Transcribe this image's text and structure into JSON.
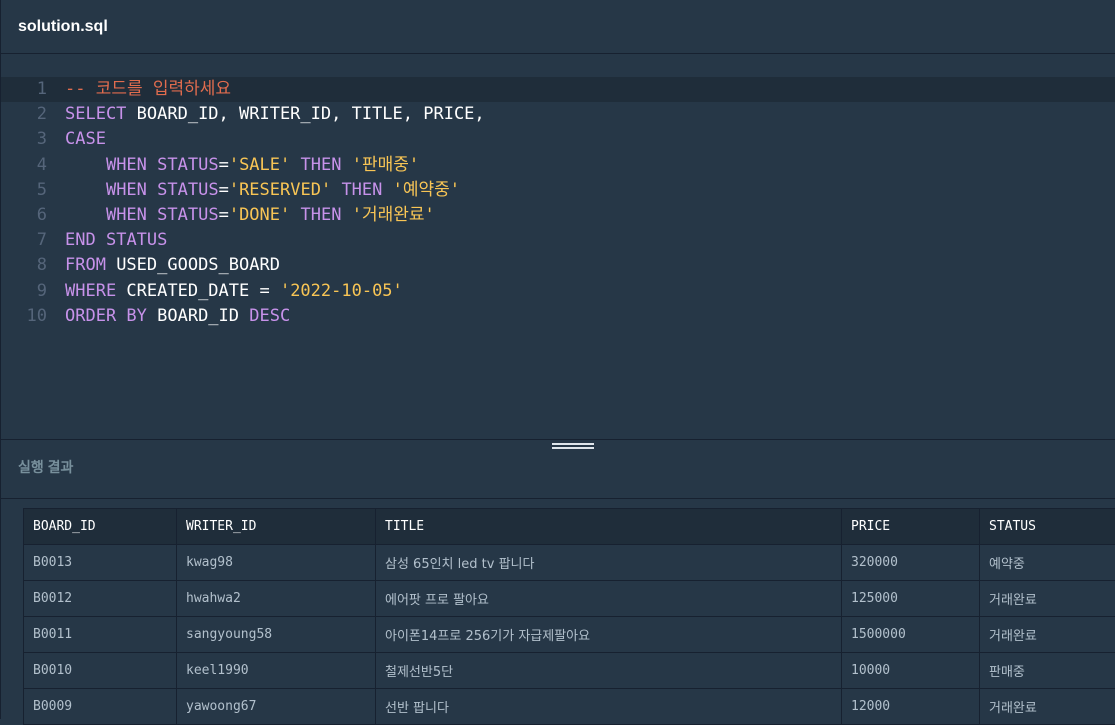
{
  "file_tab": {
    "name": "solution.sql"
  },
  "editor": {
    "active_line": 1,
    "lines": [
      {
        "n": "1",
        "tokens": [
          {
            "t": "cm",
            "v": "-- 코드를 입력하세요"
          }
        ]
      },
      {
        "n": "2",
        "tokens": [
          {
            "t": "kw",
            "v": "SELECT"
          },
          {
            "t": "id",
            "v": " BOARD_ID, WRITER_ID, TITLE, PRICE,"
          }
        ]
      },
      {
        "n": "3",
        "tokens": [
          {
            "t": "kw",
            "v": "CASE"
          }
        ]
      },
      {
        "n": "4",
        "tokens": [
          {
            "t": "id",
            "v": "    "
          },
          {
            "t": "kw",
            "v": "WHEN"
          },
          {
            "t": "id",
            "v": " "
          },
          {
            "t": "kw",
            "v": "STATUS"
          },
          {
            "t": "id",
            "v": "="
          },
          {
            "t": "str",
            "v": "'SALE'"
          },
          {
            "t": "id",
            "v": " "
          },
          {
            "t": "kw",
            "v": "THEN"
          },
          {
            "t": "id",
            "v": " "
          },
          {
            "t": "str",
            "v": "'판매중'"
          }
        ]
      },
      {
        "n": "5",
        "tokens": [
          {
            "t": "id",
            "v": "    "
          },
          {
            "t": "kw",
            "v": "WHEN"
          },
          {
            "t": "id",
            "v": " "
          },
          {
            "t": "kw",
            "v": "STATUS"
          },
          {
            "t": "id",
            "v": "="
          },
          {
            "t": "str",
            "v": "'RESERVED'"
          },
          {
            "t": "id",
            "v": " "
          },
          {
            "t": "kw",
            "v": "THEN"
          },
          {
            "t": "id",
            "v": " "
          },
          {
            "t": "str",
            "v": "'예약중'"
          }
        ]
      },
      {
        "n": "6",
        "tokens": [
          {
            "t": "id",
            "v": "    "
          },
          {
            "t": "kw",
            "v": "WHEN"
          },
          {
            "t": "id",
            "v": " "
          },
          {
            "t": "kw",
            "v": "STATUS"
          },
          {
            "t": "id",
            "v": "="
          },
          {
            "t": "str",
            "v": "'DONE'"
          },
          {
            "t": "id",
            "v": " "
          },
          {
            "t": "kw",
            "v": "THEN"
          },
          {
            "t": "id",
            "v": " "
          },
          {
            "t": "str",
            "v": "'거래완료'"
          }
        ]
      },
      {
        "n": "7",
        "tokens": [
          {
            "t": "kw",
            "v": "END"
          },
          {
            "t": "id",
            "v": " "
          },
          {
            "t": "kw",
            "v": "STATUS"
          }
        ]
      },
      {
        "n": "8",
        "tokens": [
          {
            "t": "kw",
            "v": "FROM"
          },
          {
            "t": "id",
            "v": " USED_GOODS_BOARD"
          }
        ]
      },
      {
        "n": "9",
        "tokens": [
          {
            "t": "kw",
            "v": "WHERE"
          },
          {
            "t": "id",
            "v": " CREATED_DATE = "
          },
          {
            "t": "str",
            "v": "'2022-10-05'"
          }
        ]
      },
      {
        "n": "10",
        "tokens": [
          {
            "t": "kw",
            "v": "ORDER BY"
          },
          {
            "t": "id",
            "v": " BOARD_ID "
          },
          {
            "t": "kw",
            "v": "DESC"
          }
        ]
      }
    ]
  },
  "result": {
    "label": "실행 결과",
    "columns": [
      "BOARD_ID",
      "WRITER_ID",
      "TITLE",
      "PRICE",
      "STATUS"
    ],
    "rows": [
      [
        "B0013",
        "kwag98",
        "삼성 65인치 led tv 팝니다",
        "320000",
        "예약중"
      ],
      [
        "B0012",
        "hwahwa2",
        "에어팟 프로 팔아요",
        "125000",
        "거래완료"
      ],
      [
        "B0011",
        "sangyoung58",
        "아이폰14프로 256기가 자급제팔아요",
        "1500000",
        "거래완료"
      ],
      [
        "B0010",
        "keel1990",
        "철제선반5단",
        "10000",
        "판매중"
      ],
      [
        "B0009",
        "yawoong67",
        "선반 팝니다",
        "12000",
        "거래완료"
      ]
    ]
  },
  "colors": {
    "background": "#263747",
    "keyword": "#c792ea",
    "string": "#f8c555",
    "comment": "#e06c4e",
    "identifier": "#ffffff"
  },
  "icons": {
    "resize_handle": "drag-handle-icon"
  }
}
